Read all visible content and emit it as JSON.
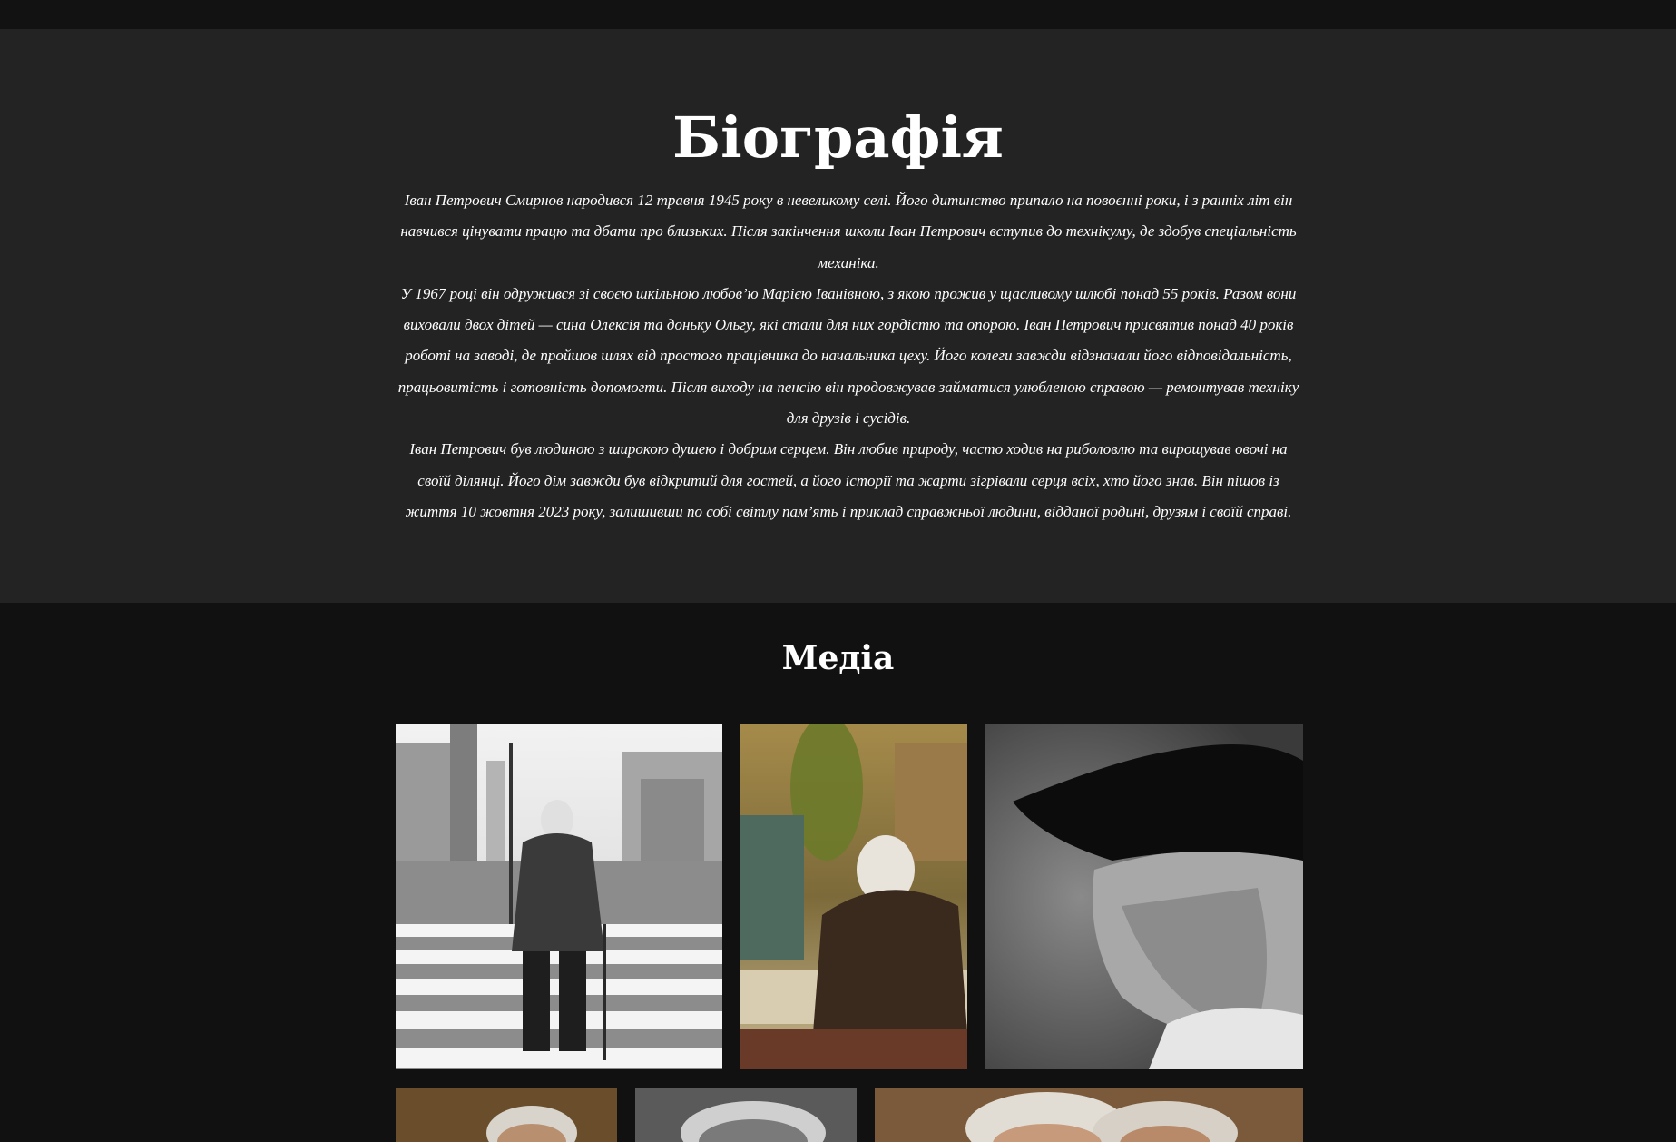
{
  "biography": {
    "title": "Біографія",
    "paragraphs": [
      "Іван Петрович Смирнов народився 12 травня 1945 року в невеликому селі. Його дитинство припало на повоєнні роки, і з ранніх літ він навчився цінувати працю та дбати про близьких. Після закінчення школи Іван Петрович вступив до технікуму, де здобув спеціальність механіка.",
      "У 1967 році він одружився зі своєю шкільною любов’ю Марією Іванівною, з якою прожив у щасливому шлюбі понад 55 років. Разом вони виховали двох дітей — сина Олексія та доньку Ольгу, які стали для них гордістю та опорою. Іван Петрович присвятив понад 40 років роботі на заводі, де пройшов шлях від простого працівника до начальника цеху. Його колеги завжди відзначали його відповідальність, працьовитість і готовність допомогти. Після виходу на пенсію він продовжував займатися улюбленою справою — ремонтував техніку для друзів і сусідів.",
      "Іван Петрович був людиною з широкою душею і добрим серцем. Він любив природу, часто ходив на риболовлю та вирощував овочі на своїй ділянці. Його дім завжди був відкритий для гостей, а його історії та жарти зігрівали серця всіх, хто його знав. Він пішов із життя 10 жовтня 2023 року, залишивши по собі світлу пам’ять і приклад справжньої людини, відданої родині, друзям і своїй справі."
    ]
  },
  "media": {
    "title": "Медіа"
  },
  "colors": {
    "page_background": "#111111",
    "biography_background": "#232323",
    "text": "#ffffff"
  }
}
